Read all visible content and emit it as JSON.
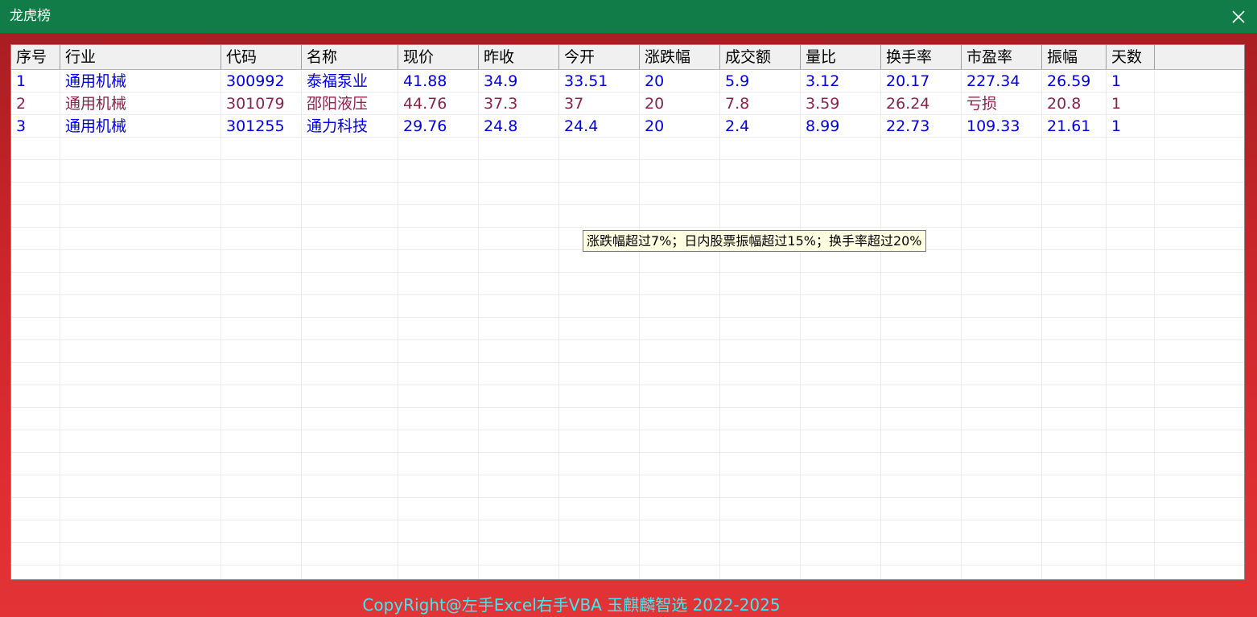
{
  "window": {
    "title": "龙虎榜"
  },
  "icons": {
    "close": "close-icon"
  },
  "colors": {
    "title_bar": "#117c47",
    "blue_row_text": "#0000e6",
    "maroon_row_text": "#8b2348",
    "footer_text": "#40e8f0",
    "tooltip_bg": "#ffffe1"
  },
  "table": {
    "columns": [
      "序号",
      "行业",
      "代码",
      "名称",
      "现价",
      "昨收",
      "今开",
      "涨跌幅",
      "成交额",
      "量比",
      "换手率",
      "市盈率",
      "振幅",
      "天数"
    ],
    "rows": [
      {
        "style": "blue",
        "cells": [
          "1",
          "通用机械",
          "300992",
          "泰福泵业",
          "41.88",
          "34.9",
          "33.51",
          "20",
          "5.9",
          "3.12",
          "20.17",
          "227.34",
          "26.59",
          "1"
        ]
      },
      {
        "style": "maroon",
        "cells": [
          "2",
          "通用机械",
          "301079",
          "邵阳液压",
          "44.76",
          "37.3",
          "37",
          "20",
          "7.8",
          "3.59",
          "26.24",
          "亏损",
          "20.8",
          "1"
        ]
      },
      {
        "style": "blue",
        "cells": [
          "3",
          "通用机械",
          "301255",
          "通力科技",
          "29.76",
          "24.8",
          "24.4",
          "20",
          "2.4",
          "8.99",
          "22.73",
          "109.33",
          "21.61",
          "1"
        ]
      }
    ]
  },
  "tooltip": {
    "text": "涨跌幅超过7%；日内股票振幅超过15%；换手率超过20%"
  },
  "footer": {
    "text": "CopyRight@左手Excel右手VBA 玉麒麟智选  2022-2025"
  }
}
